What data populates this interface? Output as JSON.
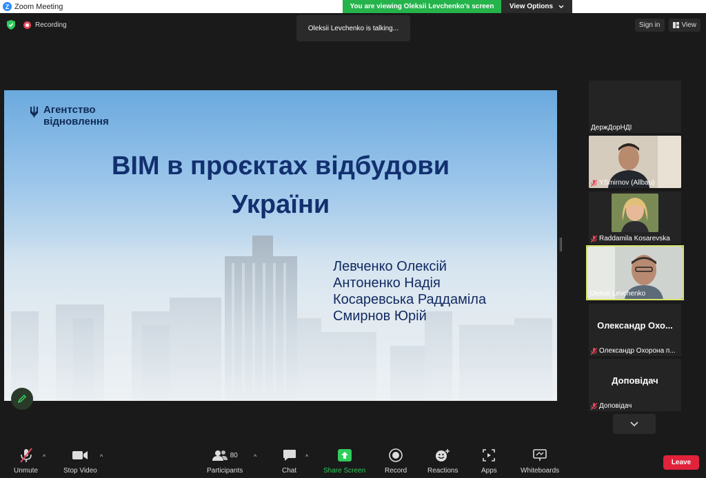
{
  "window": {
    "title": "Zoom Meeting"
  },
  "banner": {
    "message": "You are viewing Oleksii Levchenko's screen",
    "options_label": "View Options"
  },
  "status": {
    "recording_label": "Recording",
    "talking": "Oleksii Levchenko is talking..."
  },
  "top_right": {
    "signin_label": "Sign in",
    "view_label": "View"
  },
  "slide": {
    "agency_line1": "Агентство",
    "agency_line2": "відновлення",
    "title_line1": "BIM в проєктах відбудови",
    "title_line2": "України",
    "authors": [
      "Левченко Олексій",
      "Антоненко Надія",
      "Косаревська Раддаміла",
      "Смирнов Юрій"
    ]
  },
  "participants": [
    {
      "label": "ДержДорНДІ",
      "muted": false,
      "video": false,
      "bigname": ""
    },
    {
      "label": "YSmirnov (Allbau)",
      "muted": true,
      "video": true,
      "bigname": ""
    },
    {
      "label": "Raddamila Kosarevska",
      "muted": true,
      "video": true,
      "bigname": ""
    },
    {
      "label": "Oleksii Levchenko",
      "muted": false,
      "video": true,
      "bigname": ""
    },
    {
      "label": "Олександр Охорона п...",
      "muted": true,
      "video": false,
      "bigname": "Олександр Охо..."
    },
    {
      "label": "Доповідач",
      "muted": true,
      "video": false,
      "bigname": "Доповідач"
    }
  ],
  "toolbar": {
    "unmute": "Unmute",
    "stop_video": "Stop Video",
    "participants": "Participants",
    "participants_count": "80",
    "chat": "Chat",
    "share_screen": "Share Screen",
    "record": "Record",
    "reactions": "Reactions",
    "apps": "Apps",
    "whiteboards": "Whiteboards",
    "leave": "Leave"
  },
  "colors": {
    "accent_green": "#25b34b",
    "leave_red": "#e0233a",
    "active_border": "#d9e36a",
    "slide_text": "#12306f"
  }
}
